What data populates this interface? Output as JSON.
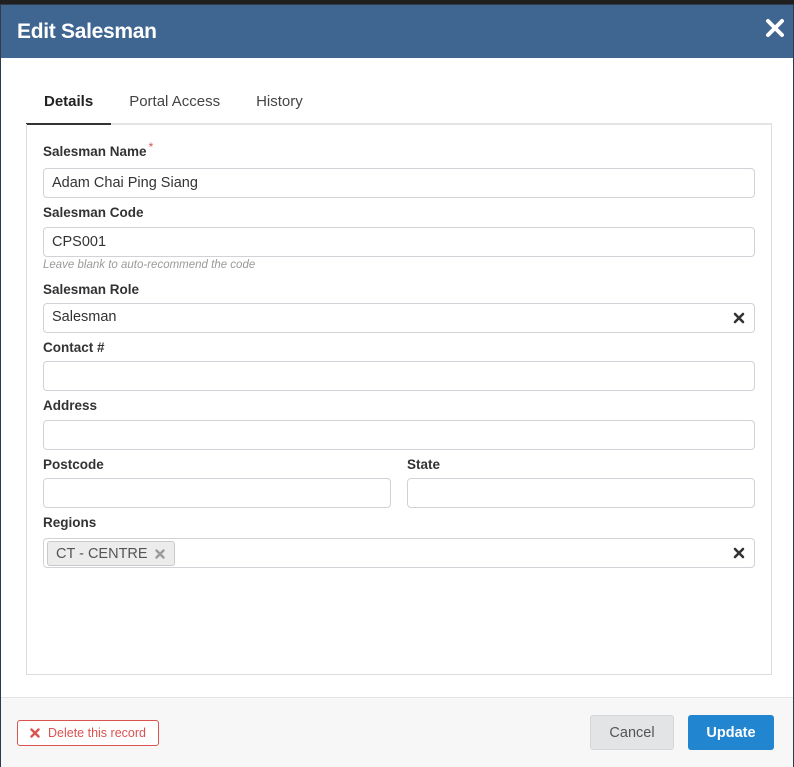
{
  "modal": {
    "title": "Edit Salesman",
    "close_icon": "close-icon"
  },
  "tabs": [
    {
      "label": "Details",
      "active": true
    },
    {
      "label": "Portal Access",
      "active": false
    },
    {
      "label": "History",
      "active": false
    }
  ],
  "form": {
    "salesman_name": {
      "label": "Salesman Name",
      "required_mark": "*",
      "value": "Adam Chai Ping Siang"
    },
    "salesman_code": {
      "label": "Salesman Code",
      "value": "CPS001",
      "hint": "Leave blank to auto-recommend the code"
    },
    "salesman_role": {
      "label": "Salesman Role",
      "value": "Salesman"
    },
    "contact": {
      "label": "Contact #",
      "value": ""
    },
    "address": {
      "label": "Address",
      "value": ""
    },
    "postcode": {
      "label": "Postcode",
      "value": ""
    },
    "state": {
      "label": "State",
      "value": ""
    },
    "regions": {
      "label": "Regions",
      "selected": [
        "CT - CENTRE"
      ]
    }
  },
  "footer": {
    "delete_label": "Delete this record",
    "cancel_label": "Cancel",
    "update_label": "Update"
  },
  "colors": {
    "header": "#3f6591",
    "primary": "#2185d0",
    "danger": "#d9534f"
  }
}
